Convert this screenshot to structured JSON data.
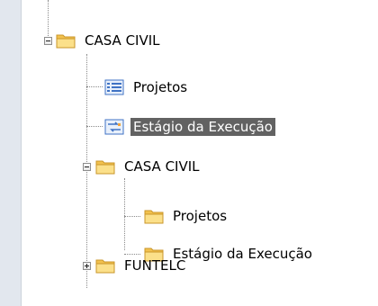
{
  "tree": {
    "root": {
      "label": "CASA CIVIL",
      "icon": "folder-icon",
      "expanded": true
    },
    "children": [
      {
        "label": "Projetos",
        "icon": "list-icon"
      },
      {
        "label": "Estágio da Execução",
        "icon": "transfer-list-icon",
        "selected": true
      },
      {
        "label": "CASA CIVIL",
        "icon": "folder-icon",
        "expanded": true,
        "children": [
          {
            "label": "Projetos",
            "icon": "folder-icon"
          },
          {
            "label": "Estágio da Execução",
            "icon": "folder-icon"
          }
        ]
      },
      {
        "label": "FUNTELC",
        "icon": "folder-icon",
        "expanded": false
      }
    ]
  },
  "colors": {
    "selection_bg": "#626262",
    "folder": "#f2c14e",
    "list_icon": "#3f72c4"
  }
}
